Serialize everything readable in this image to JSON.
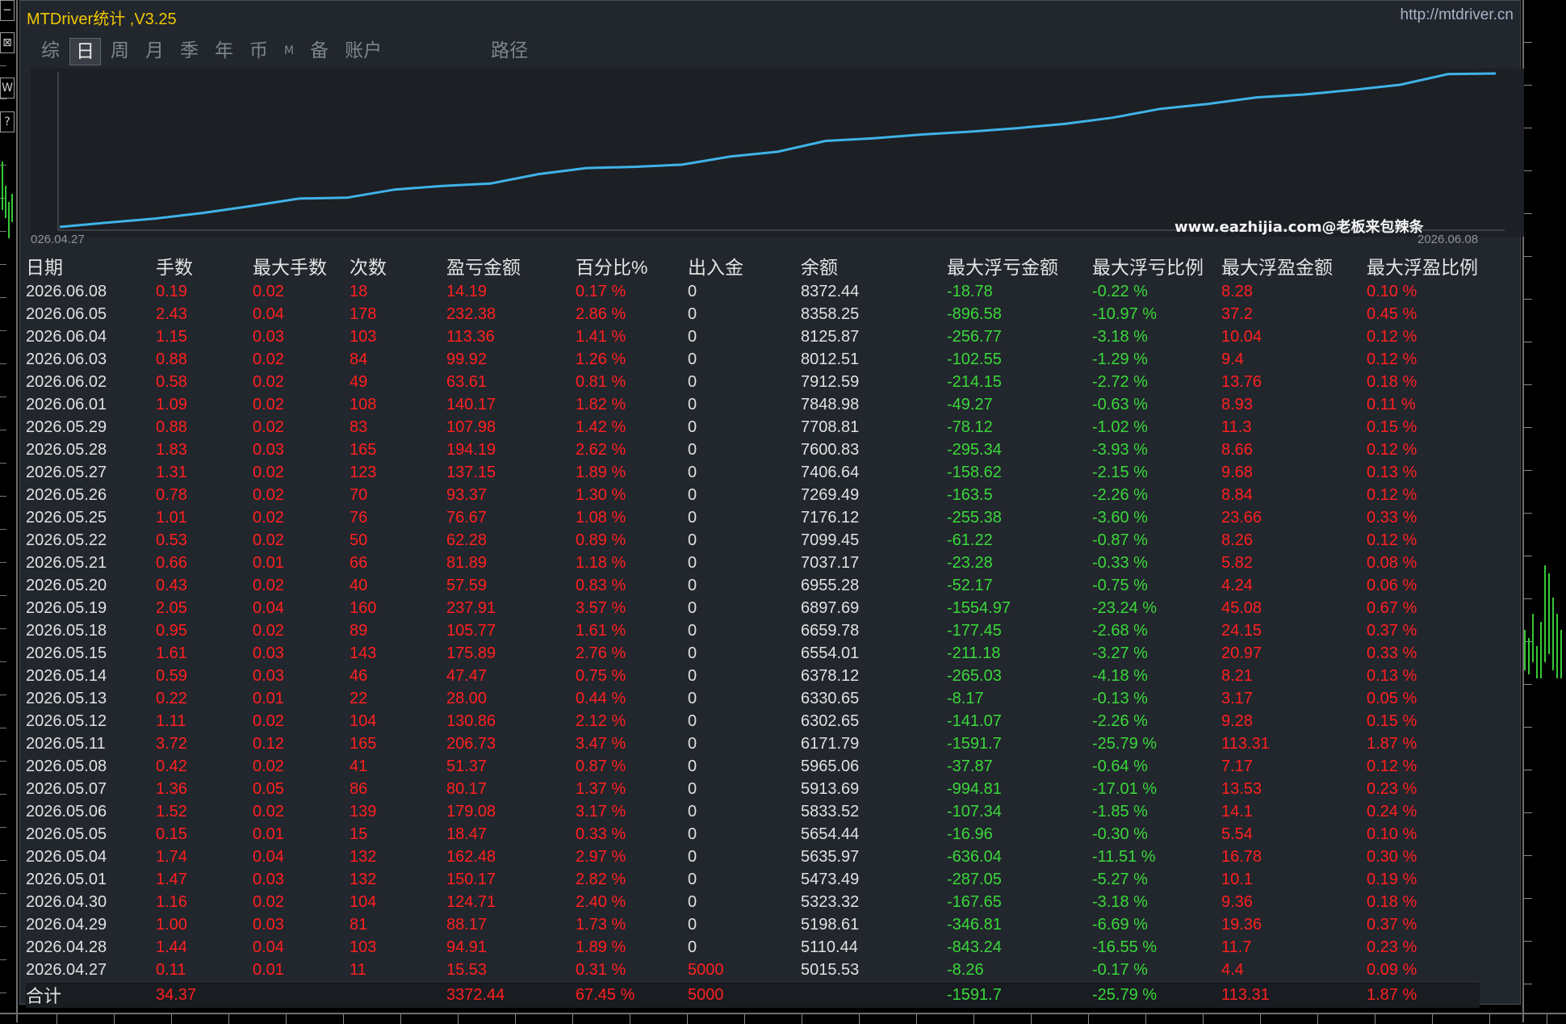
{
  "window": {
    "title": "MTDriver统计 ,V3.25",
    "url": "http://mtdriver.cn"
  },
  "tabs": [
    {
      "label": "综",
      "active": false
    },
    {
      "label": "日",
      "active": true
    },
    {
      "label": "周",
      "active": false
    },
    {
      "label": "月",
      "active": false
    },
    {
      "label": "季",
      "active": false
    },
    {
      "label": "年",
      "active": false
    },
    {
      "label": "币",
      "active": false
    },
    {
      "label": "M",
      "active": false
    },
    {
      "label": "备",
      "active": false
    },
    {
      "label": "账户",
      "active": false
    },
    {
      "label": "路径",
      "active": false
    }
  ],
  "chart": {
    "watermark": "www.eazhijia.com@老板来包辣条",
    "date_start": "026.04.27",
    "date_end": "2026.06.08",
    "line_color": "#3fb3e8"
  },
  "chart_data": {
    "type": "line",
    "x": [
      "2026.04.27",
      "2026.04.28",
      "2026.04.29",
      "2026.04.30",
      "2026.05.01",
      "2026.05.04",
      "2026.05.05",
      "2026.05.06",
      "2026.05.07",
      "2026.05.08",
      "2026.05.11",
      "2026.05.12",
      "2026.05.13",
      "2026.05.14",
      "2026.05.15",
      "2026.05.18",
      "2026.05.19",
      "2026.05.20",
      "2026.05.21",
      "2026.05.22",
      "2026.05.25",
      "2026.05.26",
      "2026.05.27",
      "2026.05.28",
      "2026.05.29",
      "2026.06.01",
      "2026.06.02",
      "2026.06.03",
      "2026.06.04",
      "2026.06.05",
      "2026.06.08"
    ],
    "series": [
      {
        "values": [
          5015.53,
          5110.44,
          5198.61,
          5323.32,
          5473.49,
          5635.97,
          5654.44,
          5833.52,
          5913.69,
          5965.06,
          6171.79,
          6302.65,
          6330.65,
          6378.12,
          6554.01,
          6659.78,
          6897.69,
          6955.28,
          7037.17,
          7099.45,
          7176.12,
          7269.49,
          7406.64,
          7600.83,
          7708.81,
          7848.98,
          7912.59,
          8012.51,
          8125.87,
          8358.25,
          8372.44
        ]
      }
    ],
    "grid": false
  },
  "table": {
    "headers": [
      "日期",
      "手数",
      "最大手数",
      "次数",
      "盈亏金额",
      "百分比%",
      "出入金",
      "余额",
      "最大浮亏金额",
      "最大浮亏比例",
      "最大浮盈金额",
      "最大浮盈比例"
    ],
    "rows": [
      [
        "2026.06.08",
        "0.19",
        "0.02",
        "18",
        "14.19",
        "0.17 %",
        "0",
        "8372.44",
        "-18.78",
        "-0.22 %",
        "8.28",
        "0.10 %"
      ],
      [
        "2026.06.05",
        "2.43",
        "0.04",
        "178",
        "232.38",
        "2.86 %",
        "0",
        "8358.25",
        "-896.58",
        "-10.97 %",
        "37.2",
        "0.45 %"
      ],
      [
        "2026.06.04",
        "1.15",
        "0.03",
        "103",
        "113.36",
        "1.41 %",
        "0",
        "8125.87",
        "-256.77",
        "-3.18 %",
        "10.04",
        "0.12 %"
      ],
      [
        "2026.06.03",
        "0.88",
        "0.02",
        "84",
        "99.92",
        "1.26 %",
        "0",
        "8012.51",
        "-102.55",
        "-1.29 %",
        "9.4",
        "0.12 %"
      ],
      [
        "2026.06.02",
        "0.58",
        "0.02",
        "49",
        "63.61",
        "0.81 %",
        "0",
        "7912.59",
        "-214.15",
        "-2.72 %",
        "13.76",
        "0.18 %"
      ],
      [
        "2026.06.01",
        "1.09",
        "0.02",
        "108",
        "140.17",
        "1.82 %",
        "0",
        "7848.98",
        "-49.27",
        "-0.63 %",
        "8.93",
        "0.11 %"
      ],
      [
        "2026.05.29",
        "0.88",
        "0.02",
        "83",
        "107.98",
        "1.42 %",
        "0",
        "7708.81",
        "-78.12",
        "-1.02 %",
        "11.3",
        "0.15 %"
      ],
      [
        "2026.05.28",
        "1.83",
        "0.03",
        "165",
        "194.19",
        "2.62 %",
        "0",
        "7600.83",
        "-295.34",
        "-3.93 %",
        "8.66",
        "0.12 %"
      ],
      [
        "2026.05.27",
        "1.31",
        "0.02",
        "123",
        "137.15",
        "1.89 %",
        "0",
        "7406.64",
        "-158.62",
        "-2.15 %",
        "9.68",
        "0.13 %"
      ],
      [
        "2026.05.26",
        "0.78",
        "0.02",
        "70",
        "93.37",
        "1.30 %",
        "0",
        "7269.49",
        "-163.5",
        "-2.26 %",
        "8.84",
        "0.12 %"
      ],
      [
        "2026.05.25",
        "1.01",
        "0.02",
        "76",
        "76.67",
        "1.08 %",
        "0",
        "7176.12",
        "-255.38",
        "-3.60 %",
        "23.66",
        "0.33 %"
      ],
      [
        "2026.05.22",
        "0.53",
        "0.02",
        "50",
        "62.28",
        "0.89 %",
        "0",
        "7099.45",
        "-61.22",
        "-0.87 %",
        "8.26",
        "0.12 %"
      ],
      [
        "2026.05.21",
        "0.66",
        "0.01",
        "66",
        "81.89",
        "1.18 %",
        "0",
        "7037.17",
        "-23.28",
        "-0.33 %",
        "5.82",
        "0.08 %"
      ],
      [
        "2026.05.20",
        "0.43",
        "0.02",
        "40",
        "57.59",
        "0.83 %",
        "0",
        "6955.28",
        "-52.17",
        "-0.75 %",
        "4.24",
        "0.06 %"
      ],
      [
        "2026.05.19",
        "2.05",
        "0.04",
        "160",
        "237.91",
        "3.57 %",
        "0",
        "6897.69",
        "-1554.97",
        "-23.24 %",
        "45.08",
        "0.67 %"
      ],
      [
        "2026.05.18",
        "0.95",
        "0.02",
        "89",
        "105.77",
        "1.61 %",
        "0",
        "6659.78",
        "-177.45",
        "-2.68 %",
        "24.15",
        "0.37 %"
      ],
      [
        "2026.05.15",
        "1.61",
        "0.03",
        "143",
        "175.89",
        "2.76 %",
        "0",
        "6554.01",
        "-211.18",
        "-3.27 %",
        "20.97",
        "0.33 %"
      ],
      [
        "2026.05.14",
        "0.59",
        "0.03",
        "46",
        "47.47",
        "0.75 %",
        "0",
        "6378.12",
        "-265.03",
        "-4.18 %",
        "8.21",
        "0.13 %"
      ],
      [
        "2026.05.13",
        "0.22",
        "0.01",
        "22",
        "28.00",
        "0.44 %",
        "0",
        "6330.65",
        "-8.17",
        "-0.13 %",
        "3.17",
        "0.05 %"
      ],
      [
        "2026.05.12",
        "1.11",
        "0.02",
        "104",
        "130.86",
        "2.12 %",
        "0",
        "6302.65",
        "-141.07",
        "-2.26 %",
        "9.28",
        "0.15 %"
      ],
      [
        "2026.05.11",
        "3.72",
        "0.12",
        "165",
        "206.73",
        "3.47 %",
        "0",
        "6171.79",
        "-1591.7",
        "-25.79 %",
        "113.31",
        "1.87 %"
      ],
      [
        "2026.05.08",
        "0.42",
        "0.02",
        "41",
        "51.37",
        "0.87 %",
        "0",
        "5965.06",
        "-37.87",
        "-0.64 %",
        "7.17",
        "0.12 %"
      ],
      [
        "2026.05.07",
        "1.36",
        "0.05",
        "86",
        "80.17",
        "1.37 %",
        "0",
        "5913.69",
        "-994.81",
        "-17.01 %",
        "13.53",
        "0.23 %"
      ],
      [
        "2026.05.06",
        "1.52",
        "0.02",
        "139",
        "179.08",
        "3.17 %",
        "0",
        "5833.52",
        "-107.34",
        "-1.85 %",
        "14.1",
        "0.24 %"
      ],
      [
        "2026.05.05",
        "0.15",
        "0.01",
        "15",
        "18.47",
        "0.33 %",
        "0",
        "5654.44",
        "-16.96",
        "-0.30 %",
        "5.54",
        "0.10 %"
      ],
      [
        "2026.05.04",
        "1.74",
        "0.04",
        "132",
        "162.48",
        "2.97 %",
        "0",
        "5635.97",
        "-636.04",
        "-11.51 %",
        "16.78",
        "0.30 %"
      ],
      [
        "2026.05.01",
        "1.47",
        "0.03",
        "132",
        "150.17",
        "2.82 %",
        "0",
        "5473.49",
        "-287.05",
        "-5.27 %",
        "10.1",
        "0.19 %"
      ],
      [
        "2026.04.30",
        "1.16",
        "0.02",
        "104",
        "124.71",
        "2.40 %",
        "0",
        "5323.32",
        "-167.65",
        "-3.18 %",
        "9.36",
        "0.18 %"
      ],
      [
        "2026.04.29",
        "1.00",
        "0.03",
        "81",
        "88.17",
        "1.73 %",
        "0",
        "5198.61",
        "-346.81",
        "-6.69 %",
        "19.36",
        "0.37 %"
      ],
      [
        "2026.04.28",
        "1.44",
        "0.04",
        "103",
        "94.91",
        "1.89 %",
        "0",
        "5110.44",
        "-843.24",
        "-16.55 %",
        "11.7",
        "0.23 %"
      ],
      [
        "2026.04.27",
        "0.11",
        "0.01",
        "11",
        "15.53",
        "0.31 %",
        "5000",
        "5015.53",
        "-8.26",
        "-0.17 %",
        "4.4",
        "0.09 %"
      ]
    ],
    "total": [
      "合计",
      "34.37",
      "",
      "",
      "3372.44",
      "67.45 %",
      "5000",
      "",
      "-1591.7",
      "-25.79 %",
      "113.31",
      "1.87 %"
    ]
  },
  "colors": {
    "title": "#f0c800",
    "positive": "#ff2020",
    "negative": "#3ad83a",
    "panel_bg": "#22262d"
  }
}
